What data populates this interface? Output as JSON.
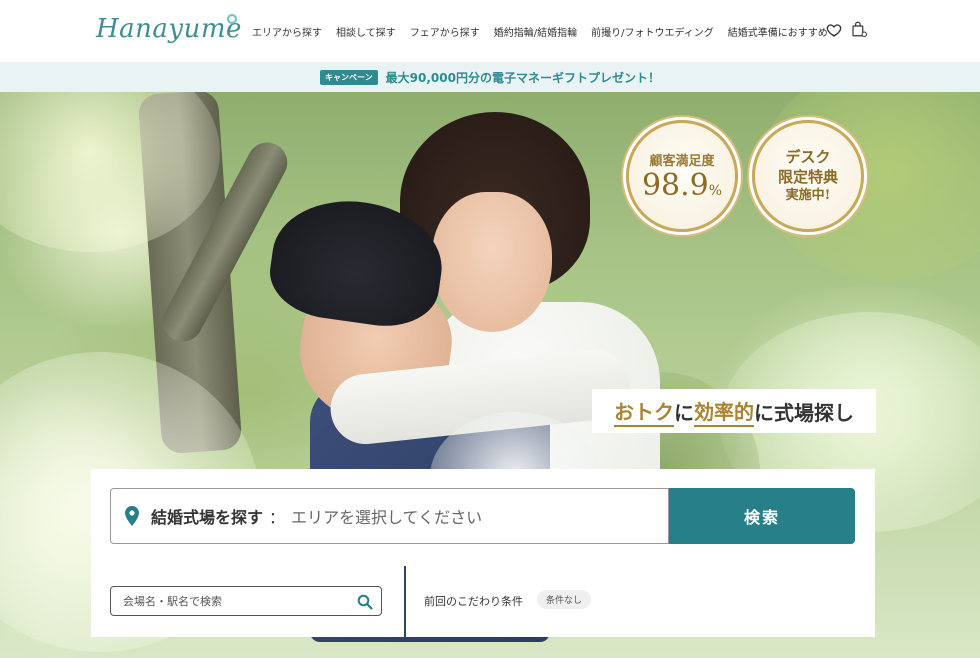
{
  "header": {
    "logo": "Hanayume",
    "nav": [
      {
        "label": "エリアから探す",
        "dropdown": false
      },
      {
        "label": "相談して探す",
        "dropdown": false
      },
      {
        "label": "フェアから探す",
        "dropdown": false
      },
      {
        "label": "婚約指輪/結婚指輪",
        "dropdown": false
      },
      {
        "label": "前撮り/フォトウエディング",
        "dropdown": false
      },
      {
        "label": "結婚式準備におすすめ",
        "dropdown": true
      }
    ],
    "icons": [
      "heart-icon",
      "bag-icon"
    ]
  },
  "campaign": {
    "badge": "キャンペーン",
    "text": "最大90,000円分の電子マネーギフトプレゼント！"
  },
  "hero": {
    "badge_satisfaction": {
      "label": "顧客満足度",
      "value": "98.9",
      "unit": "%",
      "mark": "※"
    },
    "badge_desk": {
      "line1": "デスク",
      "line2": "限定特典",
      "line3": "実施中!"
    },
    "catch": {
      "part1": "おトク",
      "part2": "に",
      "part3": "効率的",
      "part4": "に式場探し"
    }
  },
  "search": {
    "area_label": "結婚式場を探す",
    "area_separator": "：",
    "area_placeholder": "エリアを選択してください",
    "button": "検索",
    "venue_placeholder": "会場名・駅名で検索",
    "previous_label": "前回のこだわり条件",
    "previous_value": "条件なし"
  },
  "colors": {
    "brand": "#3f8e94",
    "button": "#267f89",
    "gold": "#a98432",
    "campaign_bg": "#eaf3f3"
  }
}
